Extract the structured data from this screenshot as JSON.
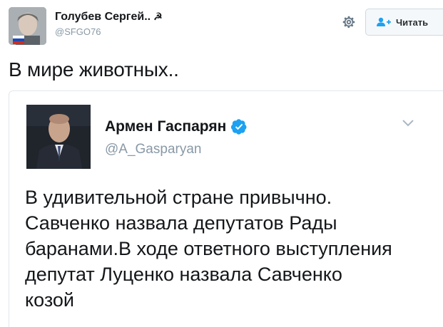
{
  "tweet": {
    "author_name": "Голубев Сергей..",
    "author_symbol": "☭",
    "author_handle": "@SFGO76",
    "text": "В мире животных.."
  },
  "actions": {
    "settings_icon": "gear-icon",
    "follow_label": "Читать",
    "follow_icon": "add-user-icon"
  },
  "quote": {
    "author_name": "Армен Гаспарян",
    "verified_icon": "verified-badge-icon",
    "author_handle": "@A_Gasparyan",
    "menu_icon": "chevron-down-icon",
    "lines": [
      "В удивительной стране привычно.",
      "Савченко назвала депутатов Рады",
      "баранами.В ходе ответного выступления",
      "депутат Луценко назвала Савченко",
      "козой"
    ]
  },
  "colors": {
    "handle": "#8899a6",
    "verified": "#1da1f2",
    "button_bg": "#f5f8fa",
    "border": "#e1e8ed"
  }
}
